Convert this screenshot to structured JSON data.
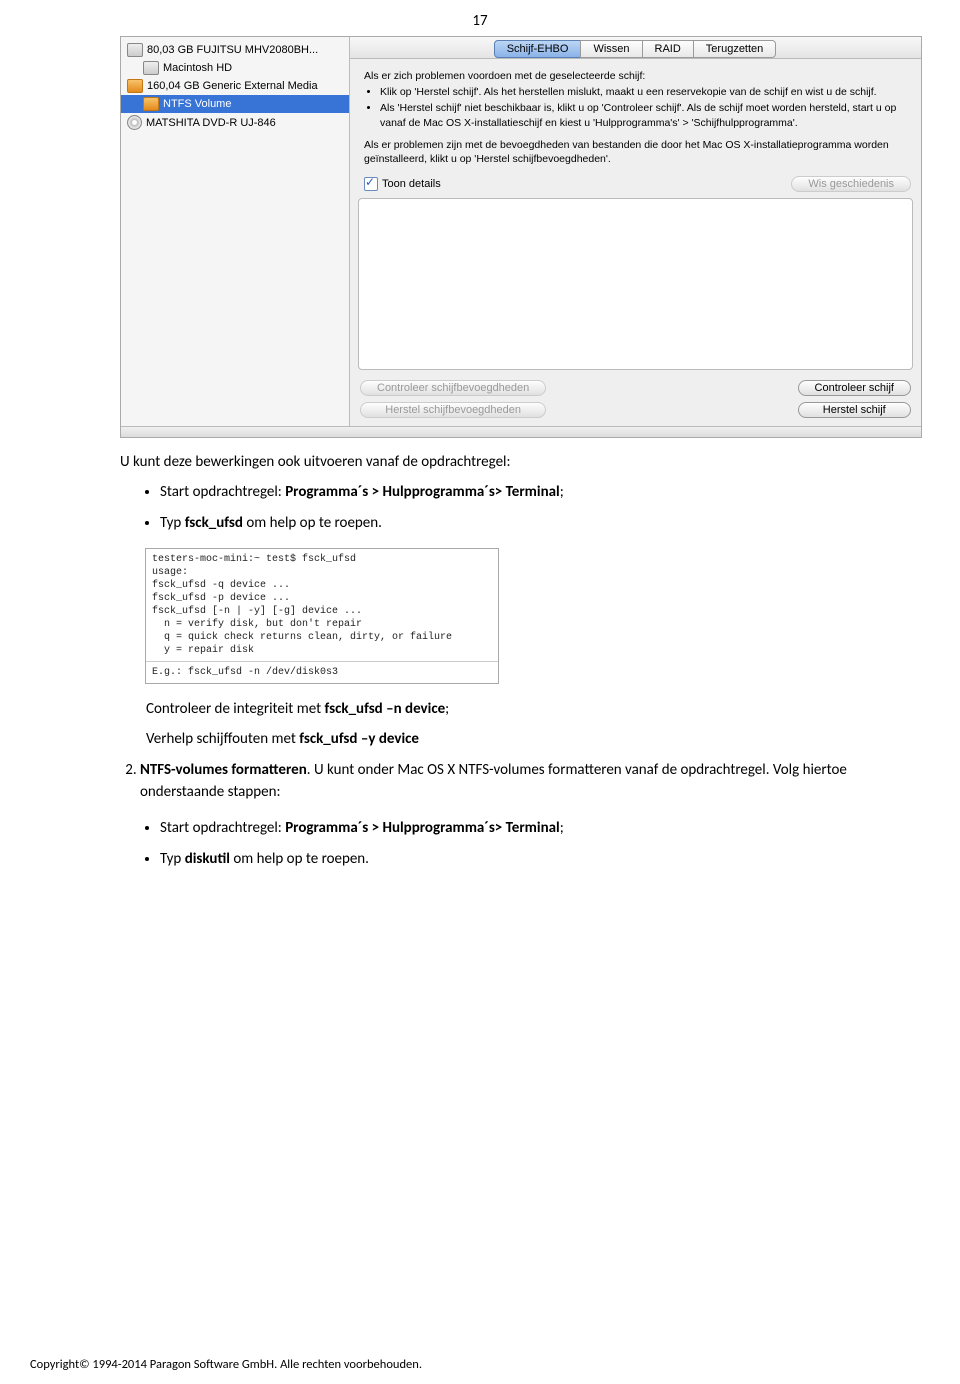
{
  "page_number": "17",
  "disk_utility": {
    "sidebar": {
      "items": [
        {
          "label": "80,03 GB FUJITSU MHV2080BH..."
        },
        {
          "label": "Macintosh HD"
        },
        {
          "label": "160,04 GB Generic External Media"
        },
        {
          "label": "NTFS Volume"
        },
        {
          "label": "MATSHITA DVD-R UJ-846"
        }
      ]
    },
    "tabs": {
      "t0": "Schijf-EHBO",
      "t1": "Wissen",
      "t2": "RAID",
      "t3": "Terugzetten"
    },
    "instructions": {
      "intro": "Als er zich problemen voordoen met de geselecteerde schijf:",
      "b0": "Klik op 'Herstel schijf'. Als het herstellen mislukt, maakt u een reservekopie van de schijf en wist u de schijf.",
      "b1": "Als 'Herstel schijf' niet beschikbaar is, klikt u op 'Controleer schijf'. Als de schijf moet worden hersteld, start u op vanaf de Mac OS X-installatieschijf en kiest u 'Hulpprogramma's' > 'Schijfhulpprogramma'.",
      "perm": "Als er problemen zijn met de bevoegdheden van bestanden die door het Mac OS X-installatieprogramma worden geïnstalleerd, klikt u op 'Herstel schijfbevoegdheden'."
    },
    "details_label": "Toon details",
    "buttons": {
      "clear_history": "Wis geschiedenis",
      "check_perm": "Controleer schijfbevoegdheden",
      "repair_perm": "Herstel schijfbevoegdheden",
      "check_disk": "Controleer schijf",
      "repair_disk": "Herstel schijf"
    }
  },
  "intro_text": "U kunt deze bewerkingen ook uitvoeren vanaf de opdrachtregel:",
  "bullets1": {
    "b0_pre": "Start opdrachtregel: ",
    "b0_bold": "Programma´s > Hulpprogramma´s> Terminal",
    "b0_post": ";",
    "b1_pre": "Typ ",
    "b1_bold": "fsck_ufsd",
    "b1_post": " om help op te roepen."
  },
  "terminal": {
    "l0": "testers-moc-mini:~ test$ fsck_ufsd",
    "l1": "usage:",
    "l2": "fsck_ufsd -q device ...",
    "l3": "fsck_ufsd -p device ...",
    "l4": "fsck_ufsd [-n | -y] [-g] device ...",
    "l5": "  n = verify disk, but don't repair",
    "l6": "  q = quick check returns clean, dirty, or failure",
    "l7": "  y = repair disk",
    "l8": "E.g.: fsck_ufsd -n /dev/disk0s3"
  },
  "after_term": {
    "line1_pre": "Controleer de integriteit met ",
    "line1_bold": "fsck_ufsd –n device",
    "line1_post": ";",
    "line2_pre": "Verhelp schijffouten met ",
    "line2_bold": "fsck_ufsd –y device"
  },
  "numbered2": {
    "title_bold": "NTFS-volumes formatteren",
    "rest": ". U kunt onder Mac OS X NTFS-volumes formatteren vanaf de opdrachtregel. Volg hiertoe onderstaande stappen:"
  },
  "bullets2": {
    "b0_pre": "Start opdrachtregel: ",
    "b0_bold": "Programma´s > Hulpprogramma´s> Terminal",
    "b0_post": ";",
    "b1_pre": "Typ ",
    "b1_bold": "diskutil",
    "b1_post": " om help op te roepen."
  },
  "footer": "Copyright© 1994-2014 Paragon Software GmbH. Alle rechten voorbehouden."
}
